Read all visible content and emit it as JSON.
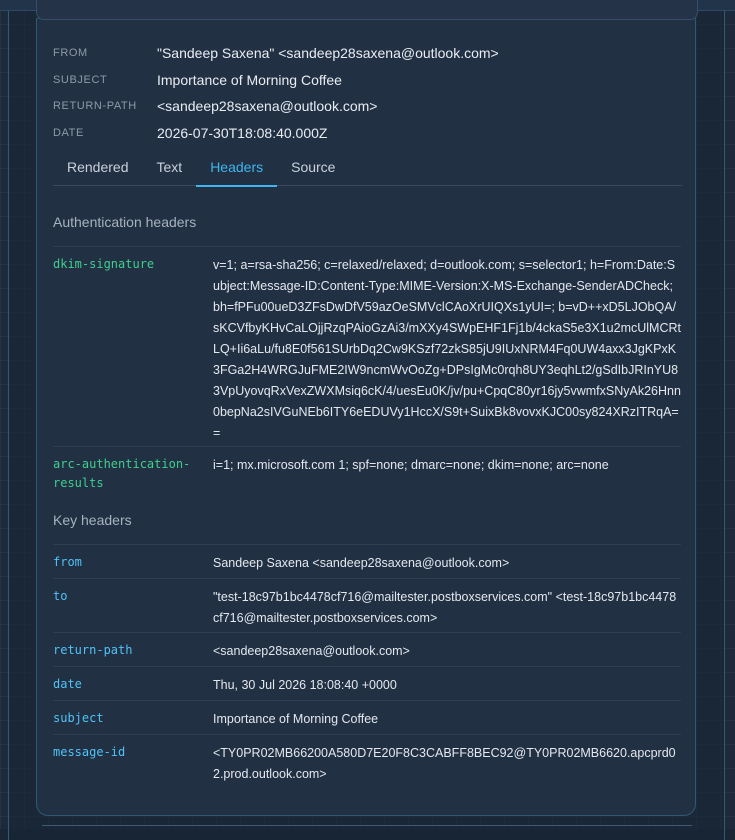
{
  "colors": {
    "auth_key": "#3ecf8e",
    "key_header_key": "#4fc3f7",
    "accent_tab": "#3db6ee"
  },
  "meta": {
    "from_label": "FROM",
    "from_value": "\"Sandeep Saxena\" <sandeep28saxena@outlook.com>",
    "subject_label": "SUBJECT",
    "subject_value": "Importance of Morning Coffee",
    "return_path_label": "RETURN-PATH",
    "return_path_value": "<sandeep28saxena@outlook.com>",
    "date_label": "DATE",
    "date_value": "2026-07-30T18:08:40.000Z"
  },
  "tabs": [
    "Rendered",
    "Text",
    "Headers",
    "Source"
  ],
  "active_tab": "Headers",
  "auth_section": {
    "title": "Authentication headers",
    "rows": [
      {
        "key": "dkim-signature",
        "value": "v=1; a=rsa-sha256; c=relaxed/relaxed; d=outlook.com; s=selector1; h=From:Date:Subject:Message-ID:Content-Type:MIME-Version:X-MS-Exchange-SenderADCheck; bh=fPFu00ueD3ZFsDwDfV59azOeSMVclCAoXrUIQXs1yUI=; b=vD++xD5LJObQA/sKCVfbyKHvCaLOjjRzqPAioGzAi3/mXXy4SWpEHF1Fj1b/4ckaS5e3X1u2mcUlMCRtLQ+Ii6aLu/fu8E0f561SUrbDq2Cw9KSzf72zkS85jU9IUxNRM4Fq0UW4axx3JgKPxK3FGa2H4WRGJuFME2IW9ncmWvOoZg+DPsIgMc0rqh8UY3eqhLt2/gSdIbJRInYU83VpUyovqRxVexZWXMsiq6cK/4/uesEu0K/jv/pu+CpqC80yr16jy5vwmfxSNyAk26Hnn0bepNa2sIVGuNEb6ITY6eEDUVy1HccX/S9t+SuixBk8vovxKJC00sy824XRzITRqA=="
      },
      {
        "key": "arc-authentication-results",
        "value": "i=1; mx.microsoft.com 1; spf=none; dmarc=none; dkim=none; arc=none"
      }
    ]
  },
  "key_section": {
    "title": "Key headers",
    "rows": [
      {
        "key": "from",
        "value": "Sandeep Saxena <sandeep28saxena@outlook.com>"
      },
      {
        "key": "to",
        "value": "\"test-18c97b1bc4478cf716@mailtester.postboxservices.com\" <test-18c97b1bc4478cf716@mailtester.postboxservices.com>"
      },
      {
        "key": "return-path",
        "value": "<sandeep28saxena@outlook.com>"
      },
      {
        "key": "date",
        "value": "Thu, 30 Jul 2026 18:08:40 +0000"
      },
      {
        "key": "subject",
        "value": "Importance of Morning Coffee"
      },
      {
        "key": "message-id",
        "value": "<TY0PR02MB66200A580D7E20F8C3CABFF8BEC92@TY0PR02MB6620.apcprd02.prod.outlook.com>"
      }
    ]
  }
}
